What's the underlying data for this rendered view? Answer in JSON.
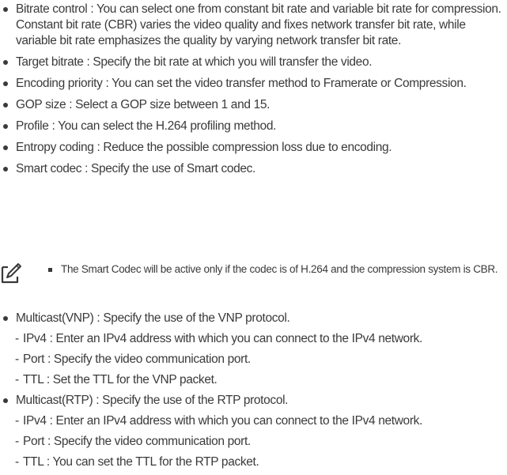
{
  "list1": [
    "Bitrate control : You can select one from constant bit rate and variable bit rate for compression. Constant bit rate (CBR) varies the video quality and fixes network transfer bit rate, while variable bit rate emphasizes the quality by varying network transfer bit rate.",
    "Target bitrate : Specify the bit rate at which you will transfer the video.",
    "Encoding priority : You can set the video transfer method to Framerate or Compression.",
    "GOP size : Select a GOP size between 1 and 15.",
    "Profile : You can select the H.264 profiling method.",
    "Entropy coding : Reduce the possible compression loss due to encoding.",
    "Smart codec : Specify the use of Smart codec."
  ],
  "note": {
    "icon": "note-pencil-icon",
    "text": "The Smart Codec will be active only if the codec is of H.264 and the compression system is CBR."
  },
  "list2": [
    {
      "text": "Multicast(VNP) : Specify the use of the VNP protocol.",
      "sub": [
        "IPv4 : Enter an IPv4 address with which you can connect to the IPv4 network.",
        "Port : Specify the video communication port.",
        "TTL : Set the TTL for the VNP packet."
      ]
    },
    {
      "text": "Multicast(RTP) : Specify the use of the RTP protocol.",
      "sub": [
        "IPv4 : Enter an IPv4 address with which you can connect to the IPv4 network.",
        "Port : Specify the video communication port.",
        "TTL : You can set the TTL for the RTP packet."
      ]
    }
  ]
}
